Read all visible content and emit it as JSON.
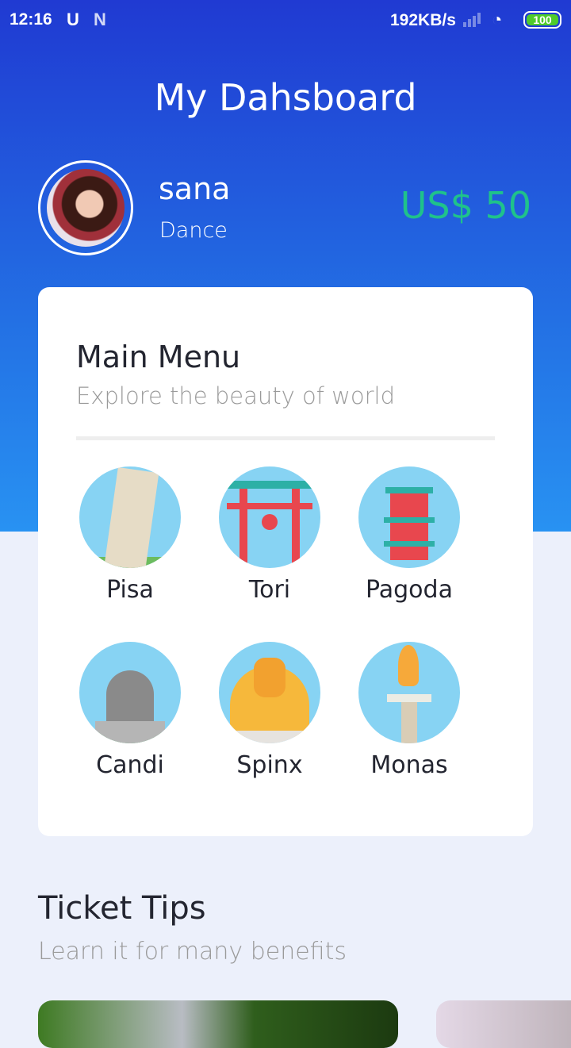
{
  "status_bar": {
    "time": "12:16",
    "speed": "192KB/s",
    "battery": "100"
  },
  "header": {
    "title": "My Dahsboard"
  },
  "profile": {
    "name": "sana",
    "role": "Dance",
    "balance": "US$ 50"
  },
  "main_menu": {
    "title": "Main Menu",
    "subtitle": "Explore the beauty of world",
    "items": [
      {
        "label": "Pisa",
        "icon": "pisa-tower-icon"
      },
      {
        "label": "Tori",
        "icon": "torii-gate-icon"
      },
      {
        "label": "Pagoda",
        "icon": "pagoda-icon"
      },
      {
        "label": "Candi",
        "icon": "candi-temple-icon"
      },
      {
        "label": "Spinx",
        "icon": "sphinx-icon"
      },
      {
        "label": "Monas",
        "icon": "monas-monument-icon"
      }
    ]
  },
  "tips": {
    "title": "Ticket Tips",
    "subtitle": "Learn it for many benefits"
  }
}
